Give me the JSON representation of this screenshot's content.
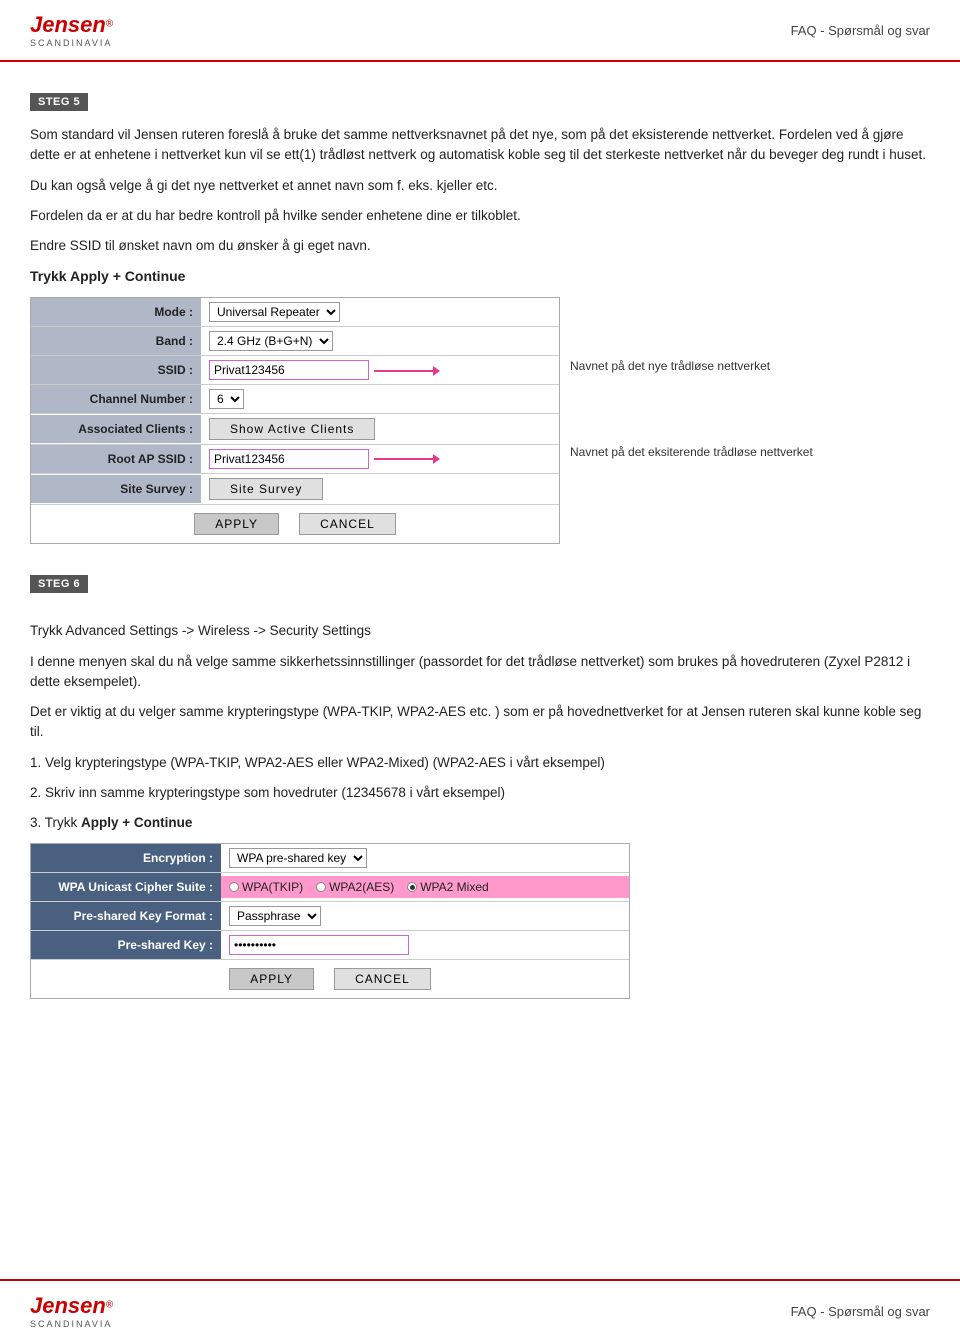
{
  "header": {
    "title": "FAQ - Spørsmål og svar",
    "logo_brand": "Jensen",
    "logo_reg": "®",
    "logo_sub": "SCANDINAVIA"
  },
  "footer": {
    "title": "FAQ - Spørsmål og svar",
    "logo_brand": "Jensen",
    "logo_reg": "®",
    "logo_sub": "SCANDINAVIA"
  },
  "step5": {
    "badge": "STEG 5",
    "para1": "Som standard vil Jensen ruteren foreslå å bruke det samme nettverksnavnet på det nye, som på det eksisterende nettverket. Fordelen ved å gjøre dette er at enhetene i nettverket kun vil se ett(1) trådløst nettverk og automatisk koble seg til det sterkeste nettverket når du beveger deg rundt i huset.",
    "para2": "Du kan også velge å gi det nye nettverket et annet navn som f. eks. kjeller etc.",
    "para3": "Fordelen da er at du har bedre kontroll på hvilke sender enhetene dine er tilkoblet.",
    "para4": "Endre SSID til ønsket navn om du ønsker å gi eget navn.",
    "trykk": "Trykk Apply + Continue",
    "form": {
      "rows": [
        {
          "label": "Mode :",
          "value": "Universal Repeater",
          "type": "select"
        },
        {
          "label": "Band :",
          "value": "2.4 GHz (B+G+N)",
          "type": "select"
        },
        {
          "label": "SSID :",
          "value": "Privat123456",
          "type": "input-pink"
        },
        {
          "label": "Channel Number :",
          "value": "6",
          "type": "select-small"
        },
        {
          "label": "Associated Clients :",
          "value": "Show Active Clients",
          "type": "button"
        },
        {
          "label": "Root AP SSID :",
          "value": "Privat123456",
          "type": "input-pink"
        },
        {
          "label": "Site Survey :",
          "value": "Site Survey",
          "type": "button-plain"
        }
      ],
      "apply_btn": "APPLY",
      "cancel_btn": "CANCEL"
    },
    "annotation1": "Navnet på det nye trådløse nettverket",
    "annotation2": "Navnet på det eksiterende trådløse nettverket"
  },
  "step6": {
    "badge": "STEG 6",
    "para1": "Trykk Advanced Settings -> Wireless -> Security Settings",
    "para2": "I denne menyen skal du nå velge samme sikkerhetssinnstillinger (passordet for det trådløse nettverket) som brukes på hovedruteren (Zyxel P2812 i dette eksempelet).",
    "para3": "Det er viktig at du velger samme krypteringstype (WPA-TKIP, WPA2-AES etc. ) som er på hovednettverket for at Jensen ruteren skal kunne koble seg til.",
    "para4a": "1. Velg krypteringstype (WPA-TKIP, WPA2-AES eller WPA2-Mixed)   (WPA2-AES i vårt eksempel)",
    "para4b": "2. Skriv inn samme krypteringstype som hovedruter (12345678 i vårt eksempel)",
    "para4c_prefix": "3. Trykk ",
    "para4c_bold": "Apply + Continue",
    "form": {
      "rows": [
        {
          "label": "Encryption :",
          "value": "WPA pre-shared key",
          "type": "select"
        },
        {
          "label": "WPA Unicast Cipher Suite :",
          "radios": [
            "WPA(TKIP)",
            "WPA2(AES)",
            "WPA2 Mixed"
          ],
          "selected": 2,
          "type": "radio"
        },
        {
          "label": "Pre-shared Key Format :",
          "value": "Passphrase",
          "type": "select"
        },
        {
          "label": "Pre-shared Key :",
          "value": "**********",
          "type": "input-pink"
        }
      ],
      "apply_btn": "APPLY",
      "cancel_btn": "CANCEL"
    }
  }
}
